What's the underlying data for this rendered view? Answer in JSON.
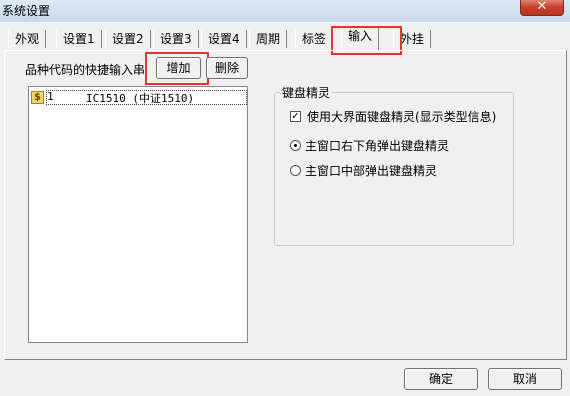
{
  "window": {
    "title": "系统设置",
    "close_glyph": "✕"
  },
  "tabs": [
    {
      "label": "外观"
    },
    {
      "label": "设置1"
    },
    {
      "label": "设置2"
    },
    {
      "label": "设置3"
    },
    {
      "label": "设置4"
    },
    {
      "label": "周期"
    },
    {
      "label": "标签"
    },
    {
      "label": "输入",
      "active": true
    },
    {
      "label": "外挂"
    }
  ],
  "shortcut": {
    "label": "品种代码的快捷输入串",
    "add_button": "增加",
    "delete_button": "删除",
    "items": [
      {
        "icon": "$",
        "num": "1",
        "code": "IC1510 (中证1510)"
      }
    ]
  },
  "wizard": {
    "legend": "键盘精灵",
    "use_large_label": "使用大界面键盘精灵(显示类型信息)",
    "use_large_checked": true,
    "options": [
      {
        "label": "主窗口右下角弹出键盘精灵",
        "selected": true
      },
      {
        "label": "主窗口中部弹出键盘精灵",
        "selected": false
      }
    ]
  },
  "footer": {
    "ok_button": "确定",
    "cancel_button": "取消"
  }
}
